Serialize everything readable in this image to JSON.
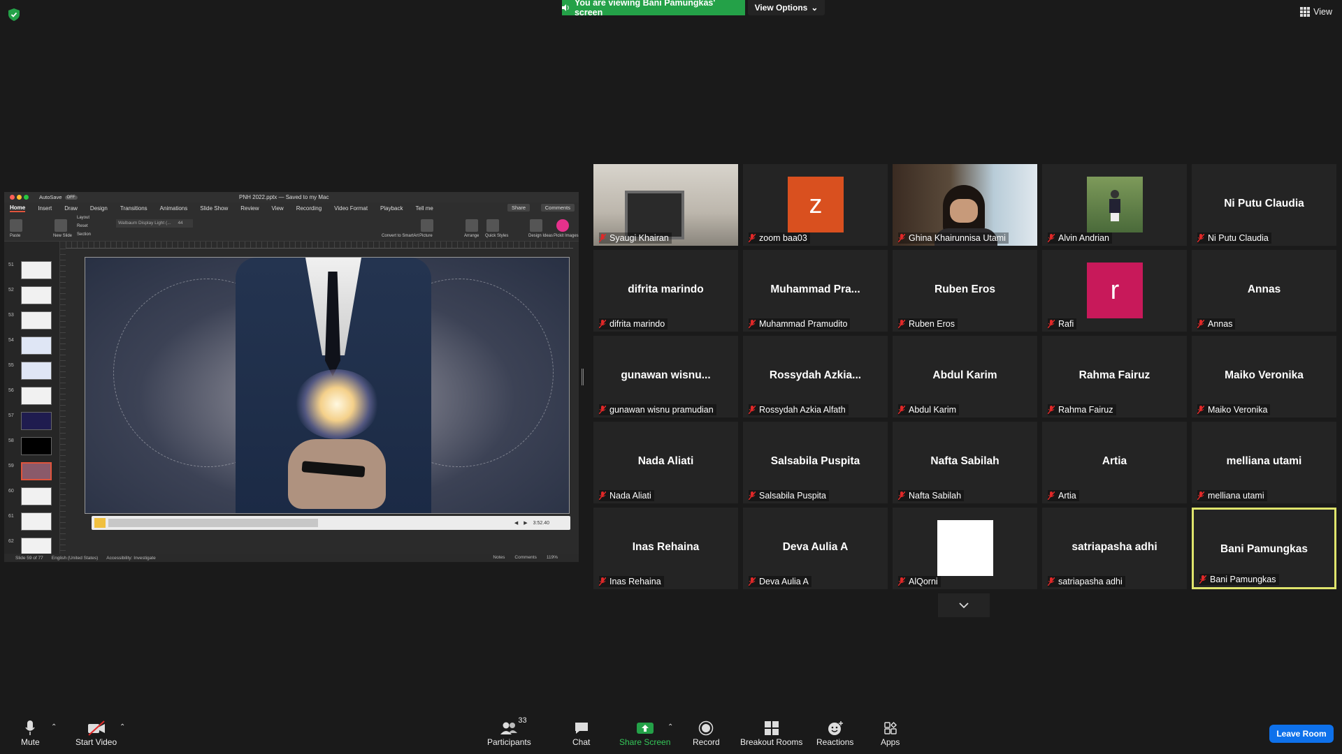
{
  "banner": {
    "viewing_text": "You are viewing Bani Pamungkas' screen",
    "view_options_label": "View Options",
    "view_label": "View"
  },
  "shared_screen": {
    "autosave_label": "AutoSave",
    "autosave_state": "OFF",
    "doc_title": "PNH 2022.pptx — Saved to my Mac",
    "tabs": [
      "Home",
      "Insert",
      "Draw",
      "Design",
      "Transitions",
      "Animations",
      "Slide Show",
      "Review",
      "View",
      "Recording",
      "Video Format",
      "Playback",
      "Tell me"
    ],
    "share_label": "Share",
    "comments_label": "Comments",
    "ribbon_labels": [
      "Paste",
      "New Slide",
      "Layout",
      "Reset",
      "Section",
      "Convert to SmartArt",
      "Picture",
      "Arrange",
      "Quick Styles",
      "Design Ideas",
      "Pickit Images"
    ],
    "font_name": "Walbaum Display Light (...",
    "font_size": "44",
    "slide_numbers": [
      "51",
      "52",
      "53",
      "54",
      "55",
      "56",
      "57",
      "58",
      "59",
      "60",
      "61",
      "62"
    ],
    "video_time": "3:52.40",
    "status_slide": "Slide 59 of 77",
    "status_lang": "English (United States)",
    "status_access": "Accessibility: Investigate",
    "status_notes": "Notes",
    "status_comments": "Comments",
    "zoom": "119%"
  },
  "participants_tiles": [
    {
      "name": "Syaugi Khairan",
      "display": "",
      "type": "camera"
    },
    {
      "name": "zoom baa03",
      "display": "z",
      "type": "avatar",
      "color": "#d9501f"
    },
    {
      "name": "Ghina Khairunnisa Utami",
      "display": "",
      "type": "camera"
    },
    {
      "name": "Alvin Andrian",
      "display": "",
      "type": "photo"
    },
    {
      "name": "Ni Putu Claudia",
      "display": "Ni Putu Claudia",
      "type": "name"
    },
    {
      "name": "difrita marindo",
      "display": "difrita marindo",
      "type": "name"
    },
    {
      "name": "Muhammad Pramudito",
      "display": "Muhammad  Pra...",
      "type": "name"
    },
    {
      "name": "Ruben Eros",
      "display": "Ruben Eros",
      "type": "name"
    },
    {
      "name": "Rafi",
      "display": "r",
      "type": "avatar",
      "color": "#c8195a"
    },
    {
      "name": "Annas",
      "display": "Annas",
      "type": "name"
    },
    {
      "name": "gunawan wisnu pramudian",
      "display": "gunawan  wisnu...",
      "type": "name"
    },
    {
      "name": "Rossydah Azkia Alfath",
      "display": "Rossydah  Azkia...",
      "type": "name"
    },
    {
      "name": "Abdul Karim",
      "display": "Abdul Karim",
      "type": "name"
    },
    {
      "name": "Rahma Fairuz",
      "display": "Rahma Fairuz",
      "type": "name"
    },
    {
      "name": "Maiko Veronika",
      "display": "Maiko Veronika",
      "type": "name"
    },
    {
      "name": "Nada Aliati",
      "display": "Nada Aliati",
      "type": "name"
    },
    {
      "name": "Salsabila Puspita",
      "display": "Salsabila Puspita",
      "type": "name"
    },
    {
      "name": "Nafta Sabilah",
      "display": "Nafta Sabilah",
      "type": "name"
    },
    {
      "name": "Artia",
      "display": "Artia",
      "type": "name"
    },
    {
      "name": "melliana utami",
      "display": "melliana utami",
      "type": "name"
    },
    {
      "name": "Inas Rehaina",
      "display": "Inas Rehaina",
      "type": "name"
    },
    {
      "name": "Deva Aulia A",
      "display": "Deva Aulia A",
      "type": "name"
    },
    {
      "name": "AlQorni",
      "display": "",
      "type": "white"
    },
    {
      "name": "satriapasha adhi",
      "display": "satriapasha adhi",
      "type": "name"
    },
    {
      "name": "Bani Pamungkas",
      "display": "Bani Pamungkas",
      "type": "name",
      "active": true
    }
  ],
  "toolbar": {
    "mute": "Mute",
    "start_video": "Start Video",
    "participants": "Participants",
    "participants_count": "33",
    "chat": "Chat",
    "share_screen": "Share Screen",
    "record": "Record",
    "breakout_rooms": "Breakout Rooms",
    "reactions": "Reactions",
    "apps": "Apps",
    "leave_room": "Leave Room"
  },
  "colors": {
    "banner_green": "#24a148",
    "active_speaker": "#dfe46c",
    "leave_blue": "#0e71eb",
    "muted_red": "#e02828"
  }
}
